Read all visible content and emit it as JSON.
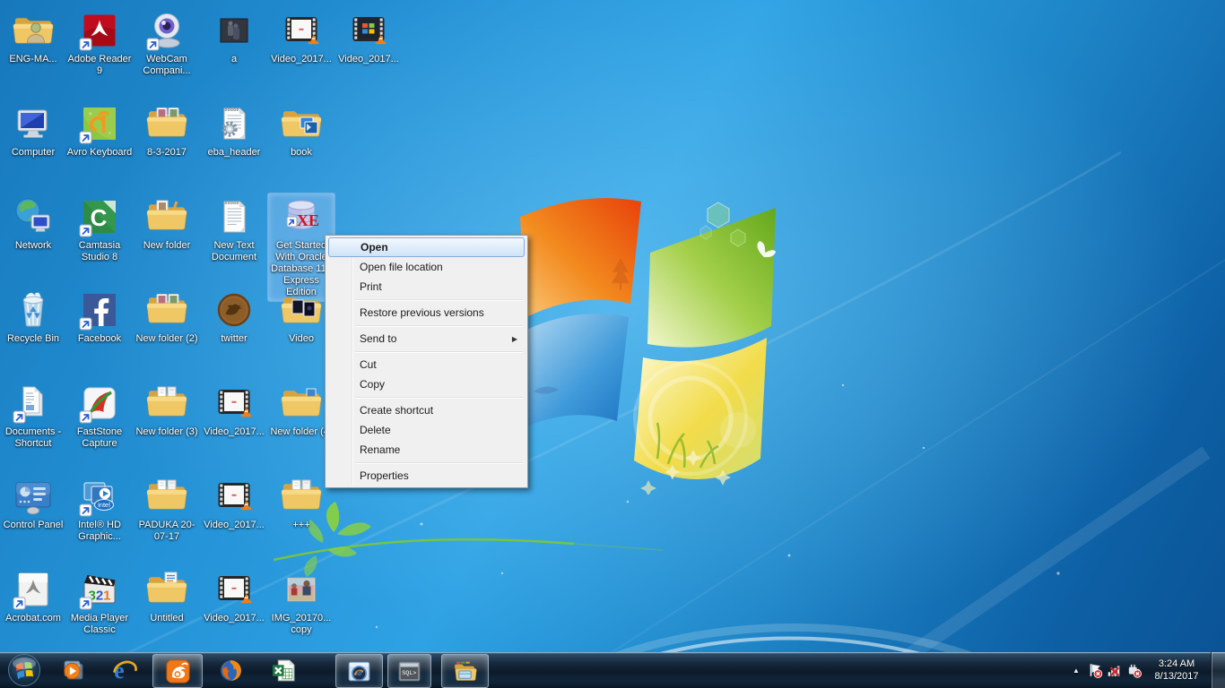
{
  "desktop": {
    "icons": [
      {
        "name": "eng-ma-folder",
        "label": "ENG-MA...",
        "type": "folder_user",
        "col": 1,
        "row": 1
      },
      {
        "name": "adobe-reader-9",
        "label": "Adobe Reader 9",
        "type": "adobe",
        "col": 2,
        "row": 1,
        "shortcut": true
      },
      {
        "name": "webcam-companion",
        "label": "WebCam Compani...",
        "type": "webcam",
        "col": 3,
        "row": 1,
        "shortcut": true
      },
      {
        "name": "photo-a",
        "label": "a",
        "type": "photo_dark",
        "col": 4,
        "row": 1
      },
      {
        "name": "video-2017-a",
        "label": "Video_2017...",
        "type": "vlc",
        "col": 5,
        "row": 1
      },
      {
        "name": "video-2017-b",
        "label": "Video_2017...",
        "type": "vlc_win",
        "col": 6,
        "row": 1
      },
      {
        "name": "computer",
        "label": "Computer",
        "type": "computer",
        "col": 1,
        "row": 2
      },
      {
        "name": "avro-keyboard",
        "label": "Avro Keyboard",
        "type": "avro",
        "col": 2,
        "row": 2,
        "shortcut": true
      },
      {
        "name": "folder-8-3-2017",
        "label": "8-3-2017",
        "type": "folder_photos",
        "col": 3,
        "row": 2
      },
      {
        "name": "eba-header",
        "label": "eba_header",
        "type": "doc_gear",
        "col": 4,
        "row": 2
      },
      {
        "name": "book-folder",
        "label": "book",
        "type": "folder_media",
        "col": 5,
        "row": 2
      },
      {
        "name": "network",
        "label": "Network",
        "type": "network",
        "col": 1,
        "row": 3
      },
      {
        "name": "camtasia-studio-8",
        "label": "Camtasia Studio 8",
        "type": "camtasia",
        "col": 2,
        "row": 3,
        "shortcut": true
      },
      {
        "name": "new-folder",
        "label": "New folder",
        "type": "folder_art",
        "col": 3,
        "row": 3
      },
      {
        "name": "new-text-document",
        "label": "New Text Document",
        "type": "text_doc",
        "col": 4,
        "row": 3
      },
      {
        "name": "oracle-xe-get-started",
        "label": "Get Started With Oracle Database 11g Express Edition",
        "type": "oracle",
        "col": 5,
        "row": 3,
        "selected": true,
        "shortcut": true
      },
      {
        "name": "recycle-bin",
        "label": "Recycle Bin",
        "type": "recycle",
        "col": 1,
        "row": 4
      },
      {
        "name": "facebook",
        "label": "Facebook",
        "type": "facebook",
        "col": 2,
        "row": 4,
        "shortcut": true
      },
      {
        "name": "new-folder-2",
        "label": "New folder (2)",
        "type": "folder_photos",
        "col": 3,
        "row": 4
      },
      {
        "name": "twitter",
        "label": "twitter",
        "type": "twitter",
        "col": 4,
        "row": 4
      },
      {
        "name": "video-folder",
        "label": "Video",
        "type": "folder_dark",
        "col": 5,
        "row": 4
      },
      {
        "name": "documents-shortcut",
        "label": "Documents - Shortcut",
        "type": "documents",
        "col": 1,
        "row": 5,
        "shortcut": true
      },
      {
        "name": "faststone-capture",
        "label": "FastStone Capture",
        "type": "faststone",
        "col": 2,
        "row": 5,
        "shortcut": true
      },
      {
        "name": "new-folder-3",
        "label": "New folder (3)",
        "type": "folder_docs",
        "col": 3,
        "row": 5
      },
      {
        "name": "video-2017-c",
        "label": "Video_2017...",
        "type": "vlc",
        "col": 4,
        "row": 5
      },
      {
        "name": "new-folder-4",
        "label": "New folder (4)",
        "type": "folder_open",
        "col": 5,
        "row": 5
      },
      {
        "name": "control-panel",
        "label": "Control Panel",
        "type": "control_panel",
        "col": 1,
        "row": 6
      },
      {
        "name": "intel-hd-graphics",
        "label": "Intel® HD Graphic...",
        "type": "intel",
        "col": 2,
        "row": 6,
        "shortcut": true
      },
      {
        "name": "paduka-20-07-17",
        "label": "PADUKA 20-07-17",
        "type": "folder_docs",
        "col": 3,
        "row": 6
      },
      {
        "name": "video-2017-d",
        "label": "Video_2017...",
        "type": "vlc",
        "col": 4,
        "row": 6
      },
      {
        "name": "plus-plus-plus",
        "label": "+++",
        "type": "folder_docs",
        "col": 5,
        "row": 6
      },
      {
        "name": "acrobat-com",
        "label": "Acrobat.com",
        "type": "acrobat",
        "col": 1,
        "row": 7,
        "shortcut": true
      },
      {
        "name": "media-player-classic",
        "label": "Media Player Classic",
        "type": "mpc",
        "col": 2,
        "row": 7,
        "shortcut": true
      },
      {
        "name": "untitled-folder",
        "label": "Untitled",
        "type": "folder_doc1",
        "col": 3,
        "row": 7
      },
      {
        "name": "video-2017-e",
        "label": "Video_2017...",
        "type": "vlc",
        "col": 4,
        "row": 7
      },
      {
        "name": "img-20170-copy",
        "label": "IMG_20170... copy",
        "type": "photo_people",
        "col": 5,
        "row": 7
      }
    ]
  },
  "icon_text": {
    "oracle": "XE",
    "camtasia": "C",
    "mpc": "321",
    "intel": "intel",
    "sqlplus": "SQL>"
  },
  "context_menu": {
    "items": [
      {
        "label": "Open",
        "bold": true,
        "highlighted": true
      },
      {
        "label": "Open file location"
      },
      {
        "label": "Print"
      },
      {
        "separator": true
      },
      {
        "label": "Restore previous versions"
      },
      {
        "separator": true
      },
      {
        "label": "Send to",
        "submenu": true
      },
      {
        "separator": true
      },
      {
        "label": "Cut"
      },
      {
        "label": "Copy"
      },
      {
        "separator": true
      },
      {
        "label": "Create shortcut"
      },
      {
        "label": "Delete"
      },
      {
        "label": "Rename"
      },
      {
        "separator": true
      },
      {
        "label": "Properties"
      }
    ]
  },
  "taskbar": {
    "buttons": [
      {
        "name": "windows-media-player",
        "icon": "wmp",
        "active": false
      },
      {
        "name": "internet-explorer",
        "icon": "ie",
        "active": false
      },
      {
        "name": "uc-browser",
        "icon": "uc",
        "active": true
      },
      {
        "name": "firefox",
        "icon": "firefox",
        "active": false
      },
      {
        "name": "excel",
        "icon": "excel",
        "active": false
      },
      {
        "name": "photo-viewer",
        "icon": "photoviewer",
        "active": true
      },
      {
        "name": "sqlplus",
        "icon": "sqlplus",
        "active": true
      },
      {
        "name": "windows-explorer",
        "icon": "explorer",
        "active": true
      }
    ],
    "clock": {
      "time": "3:24 AM",
      "date": "8/13/2017"
    }
  },
  "icons": {
    "submenu_arrow": "▶",
    "tray_chevron": "▲"
  }
}
